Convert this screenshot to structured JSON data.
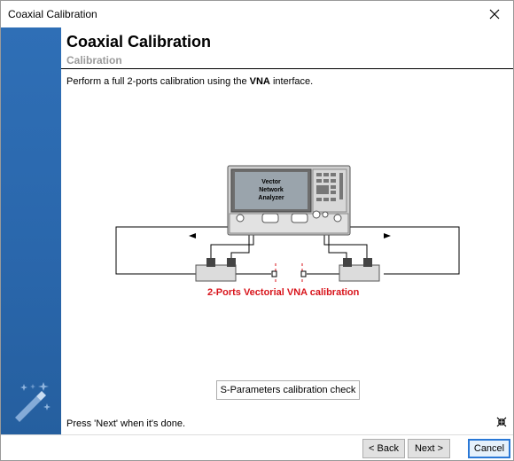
{
  "window": {
    "title": "Coaxial Calibration"
  },
  "header": {
    "title": "Coaxial Calibration",
    "subtitle": "Calibration"
  },
  "description": {
    "prefix": "Perform a full 2-ports calibration using the ",
    "emphasis": "VNA",
    "suffix": " interface."
  },
  "diagram": {
    "instrument_line1": "Vector",
    "instrument_line2": "Network",
    "instrument_line3": "Analyzer",
    "caption": "2-Ports Vectorial VNA calibration"
  },
  "buttons": {
    "sparam_check": "S-Parameters calibration check",
    "back": "< Back",
    "next": "Next >",
    "cancel": "Cancel"
  },
  "status": {
    "done_hint": "Press 'Next' when it's done."
  },
  "colors": {
    "sidebar": "#2a67ac",
    "caption": "#d8141b",
    "focus": "#2a78d6"
  }
}
